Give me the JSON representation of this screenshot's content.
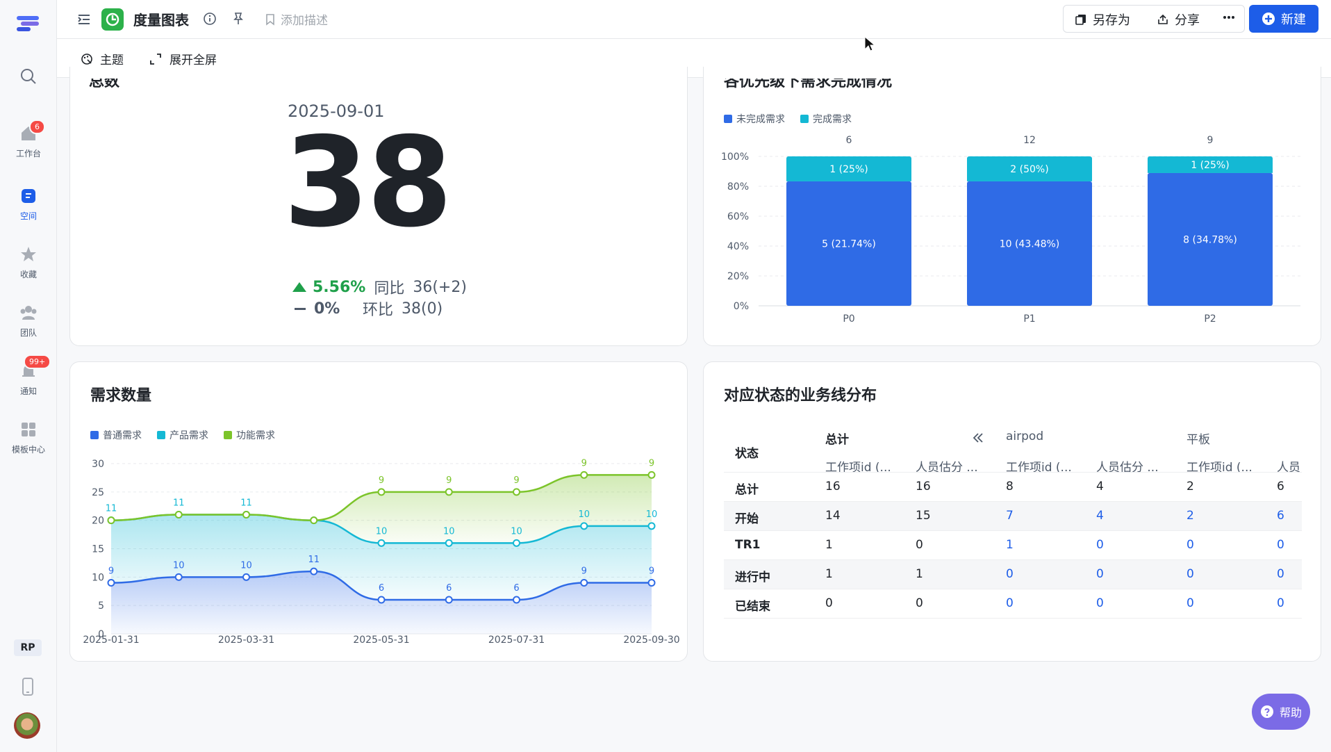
{
  "app": {
    "title": "度量图表",
    "add_description": "添加描述",
    "theme_label": "主题",
    "fullscreen_label": "展开全屏",
    "save_as_label": "另存为",
    "share_label": "分享",
    "new_label": "新建",
    "help_label": "帮助",
    "accent": "#1d5de8"
  },
  "sidebar": {
    "items": [
      {
        "label": "工作台",
        "badge": "6"
      },
      {
        "label": "空间"
      },
      {
        "label": "收藏"
      },
      {
        "label": "团队"
      },
      {
        "label": "通知",
        "badge": "99+"
      },
      {
        "label": "模板中心"
      }
    ],
    "user_initials": "RP"
  },
  "total_card": {
    "title": "总数",
    "date": "2025-09-01",
    "value": "38",
    "yoy_pct": "5.56%",
    "yoy_label": "同比",
    "yoy_value": "36(+2)",
    "mom_pct": "0%",
    "mom_label": "环比",
    "mom_value": "38(0)"
  },
  "priority_card": {
    "title": "各优先级下需求完成情况",
    "chart_data": {
      "type": "bar",
      "stacked": "percent",
      "categories": [
        "P0",
        "P1",
        "P2"
      ],
      "totals": [
        "6",
        "12",
        "9"
      ],
      "series": [
        {
          "name": "未完成需求",
          "color": "#2f6be6",
          "values": [
            5,
            10,
            8
          ],
          "labels": [
            "5 (21.74%)",
            "10 (43.48%)",
            "8 (34.78%)"
          ]
        },
        {
          "name": "完成需求",
          "color": "#14b8d4",
          "values": [
            1,
            2,
            1
          ],
          "labels": [
            "1 (25%)",
            "2 (50%)",
            "1 (25%)"
          ]
        }
      ],
      "y_ticks": [
        "0%",
        "20%",
        "40%",
        "60%",
        "80%",
        "100%"
      ],
      "ylim": [
        0,
        100
      ],
      "legend": "top-left"
    }
  },
  "count_card": {
    "title": "需求数量",
    "chart_data": {
      "type": "area",
      "x": [
        "2025-01-31",
        "2025-02-28",
        "2025-03-31",
        "2025-04-30",
        "2025-05-31",
        "2025-06-30",
        "2025-07-31",
        "2025-08-31",
        "2025-09-30"
      ],
      "x_tick_labels": [
        "2025-01-31",
        "2025-03-31",
        "2025-05-31",
        "2025-07-31",
        "2025-09-30"
      ],
      "y_ticks": [
        "0",
        "5",
        "10",
        "15",
        "20",
        "25",
        "30"
      ],
      "ylim": [
        0,
        30
      ],
      "stacked": true,
      "series": [
        {
          "name": "普通需求",
          "color": "#2f6be6",
          "values": [
            9,
            10,
            10,
            11,
            6,
            6,
            6,
            9,
            9
          ]
        },
        {
          "name": "产品需求",
          "color": "#14b8d4",
          "values": [
            11,
            11,
            11,
            9,
            10,
            10,
            10,
            10,
            10
          ]
        },
        {
          "name": "功能需求",
          "color": "#7cc42a",
          "values": [
            0,
            0,
            0,
            0,
            9,
            9,
            9,
            9,
            9
          ]
        }
      ],
      "point_labels": [
        {
          "series": "普通需求",
          "labels": [
            "9",
            "10",
            "10",
            "11",
            "6",
            "6",
            "6",
            "9",
            "9"
          ]
        },
        {
          "series": "产品需求",
          "labels": [
            "11",
            "11",
            "11",
            "",
            "10",
            "10",
            "10",
            "10",
            "10"
          ]
        },
        {
          "series": "功能需求",
          "labels": [
            "",
            "",
            "",
            "",
            "9",
            "9",
            "9",
            "9",
            "9"
          ]
        }
      ],
      "legend": "top-left"
    }
  },
  "dist_card": {
    "title": "对应状态的业务线分布",
    "header_state": "状态",
    "groups": [
      "总计",
      "airpod",
      "平板"
    ],
    "sub_headers": [
      "工作项id (...",
      "人员估分 ...",
      "工作项id (...",
      "人员估分 ...",
      "工作项id (...",
      "人员"
    ],
    "rows": [
      {
        "state": "总计",
        "cells": [
          "16",
          "16",
          "8",
          "4",
          "2",
          "6"
        ]
      },
      {
        "state": "开始",
        "cells": [
          "14",
          "15",
          "7",
          "4",
          "2",
          "6"
        ]
      },
      {
        "state": "TR1",
        "cells": [
          "1",
          "0",
          "1",
          "0",
          "0",
          "0"
        ]
      },
      {
        "state": "进行中",
        "cells": [
          "1",
          "1",
          "0",
          "0",
          "0",
          "0"
        ]
      },
      {
        "state": "已结束",
        "cells": [
          "0",
          "0",
          "0",
          "0",
          "0",
          "0"
        ]
      }
    ]
  }
}
